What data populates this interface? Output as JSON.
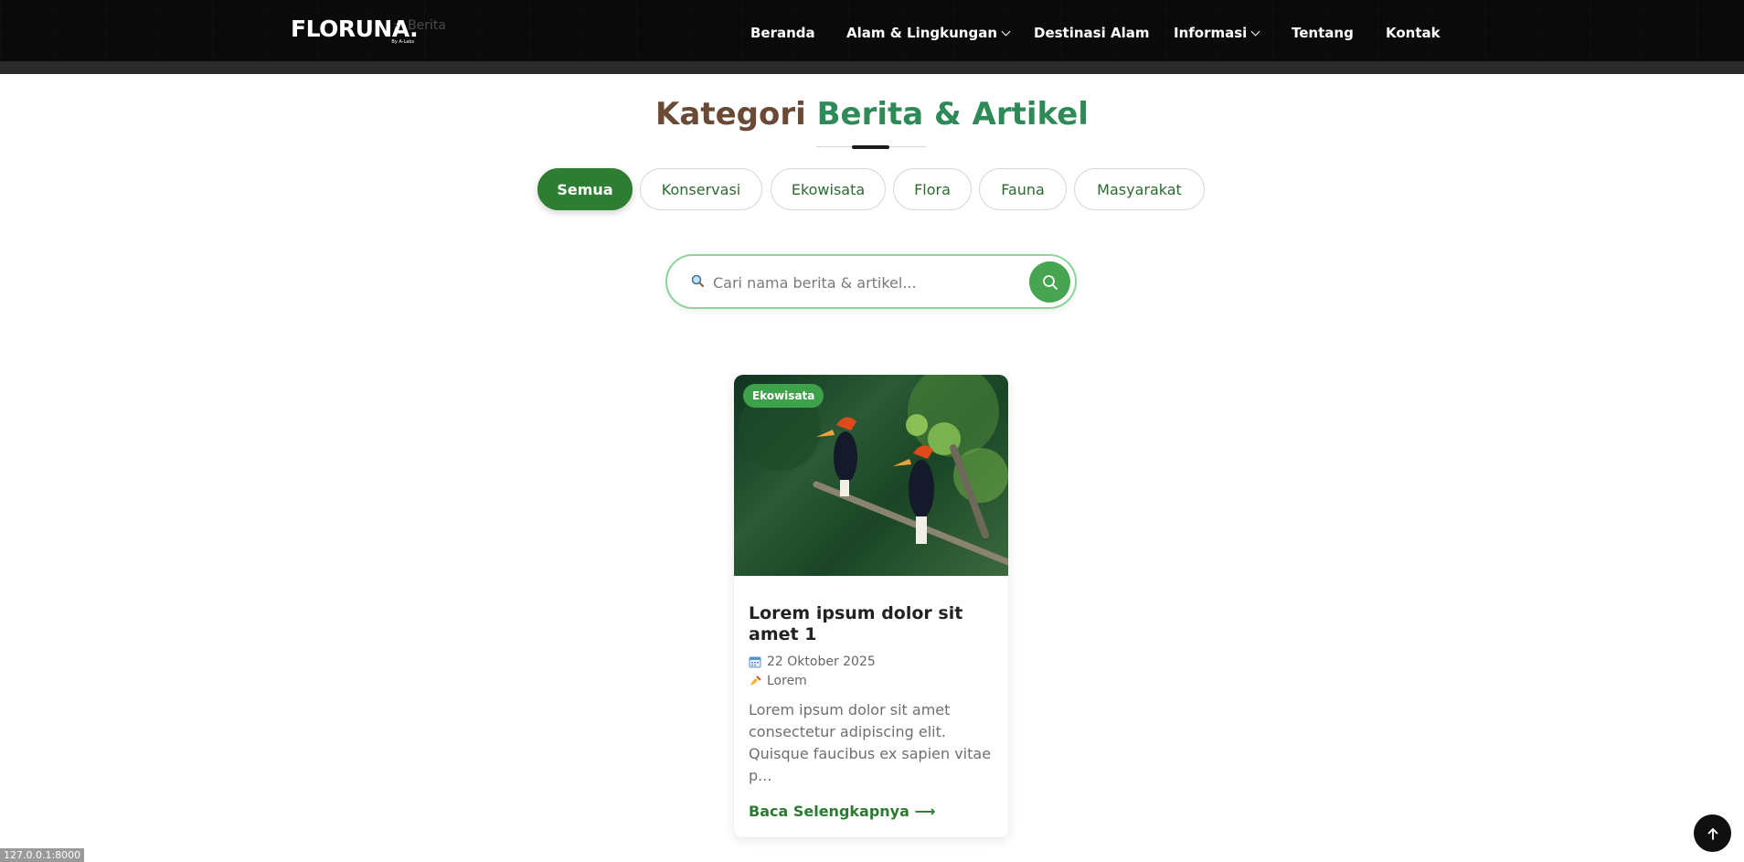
{
  "header": {
    "logo": "FLORUNA.",
    "logo_sub": "By A-Labs",
    "breadcrumb": "Berita",
    "nav": [
      {
        "label": "Beranda"
      },
      {
        "label": "Alam & Lingkungan"
      },
      {
        "label": "Destinasi Alam"
      },
      {
        "label": "Informasi"
      },
      {
        "label": "Tentang"
      },
      {
        "label": "Kontak"
      }
    ]
  },
  "section": {
    "title_part1": "Kategori",
    "title_part2": "Berita & Artikel"
  },
  "categories": [
    "Semua",
    "Konservasi",
    "Ekowisata",
    "Flora",
    "Fauna",
    "Masyarakat"
  ],
  "search": {
    "placeholder": "Cari nama berita & artikel..."
  },
  "card": {
    "badge": "Ekowisata",
    "title": "Lorem ipsum dolor sit amet 1",
    "date": "22 Oktober 2025",
    "author": "Lorem",
    "excerpt": "Lorem ipsum dolor sit amet consectetur adipiscing elit. Quisque faucibus ex sapien vitae p...",
    "read_more": "Baca Selengkapnya ⟶"
  },
  "status_bar": "127.0.0.1:8000",
  "colors": {
    "brand_green": "#2d7d32",
    "accent_green": "#2e8b57",
    "brown": "#6b4a35"
  }
}
